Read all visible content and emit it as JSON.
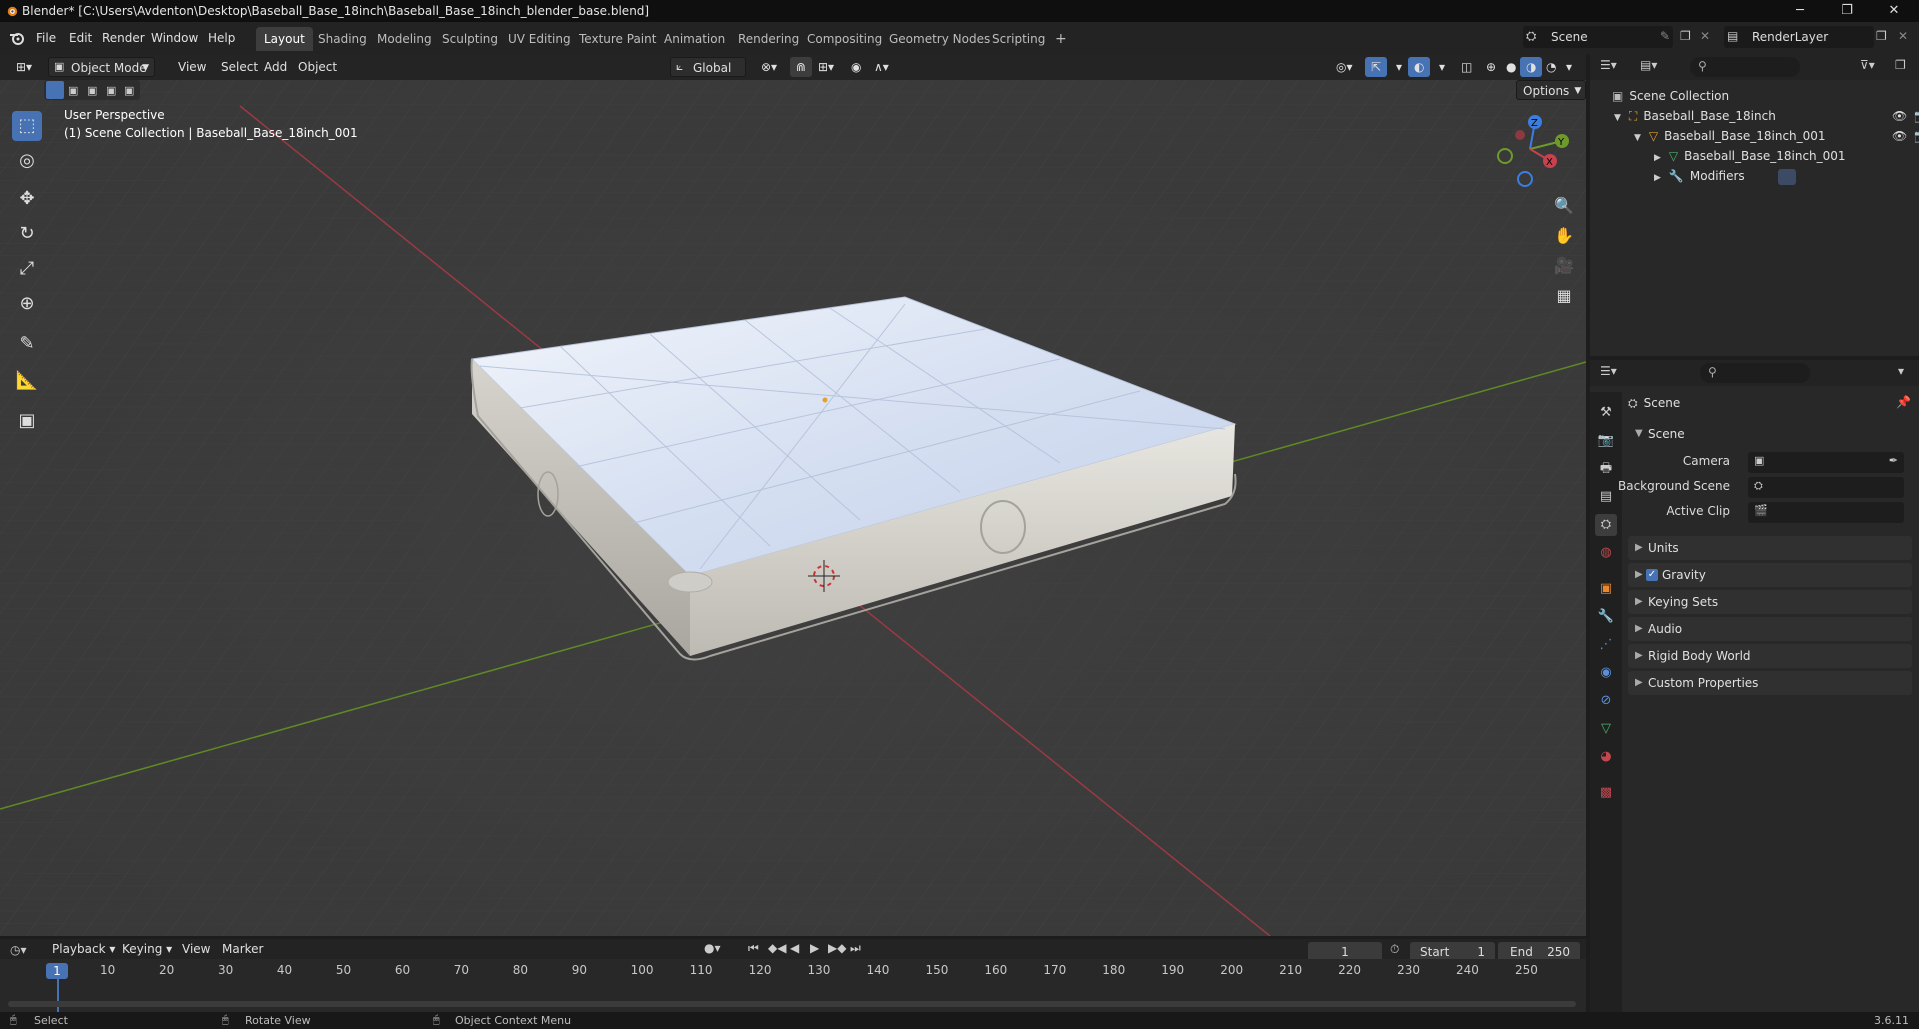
{
  "window": {
    "title": "Blender* [C:\\Users\\Avdenton\\Desktop\\Baseball_Base_18inch\\Baseball_Base_18inch_blender_base.blend]",
    "minimize": "─",
    "maximize": "❐",
    "close": "✕"
  },
  "menus": [
    "File",
    "Edit",
    "Render",
    "Window",
    "Help"
  ],
  "workspaces": [
    "Layout",
    "Shading",
    "Modeling",
    "Sculpting",
    "UV Editing",
    "Texture Paint",
    "Animation",
    "Rendering",
    "Compositing",
    "Geometry Nodes",
    "Scripting",
    "+"
  ],
  "active_workspace": "Layout",
  "scene_selector": "Scene",
  "view_layer": "RenderLayer",
  "viewport_header": {
    "mode": "Object Mode",
    "menus": [
      "View",
      "Select",
      "Add",
      "Object"
    ],
    "orientation": "Global",
    "options": "Options"
  },
  "viewport": {
    "perspective": "User Perspective",
    "collection_info": "(1) Scene Collection | Baseball_Base_18inch_001",
    "axis_x": "X",
    "axis_y": "Y",
    "axis_z": "Z"
  },
  "outliner": {
    "root": "Scene Collection",
    "items": [
      {
        "label": "Baseball_Base_18inch",
        "level": 0
      },
      {
        "label": "Baseball_Base_18inch_001",
        "level": 1
      },
      {
        "label": "Baseball_Base_18inch_001",
        "level": 2
      },
      {
        "label": "Modifiers",
        "level": 2
      }
    ]
  },
  "properties": {
    "context_title": "Scene",
    "section": "Scene",
    "fields": [
      {
        "label": "Camera"
      },
      {
        "label": "Background Scene"
      },
      {
        "label": "Active Clip"
      }
    ],
    "panels": [
      "Units",
      "Gravity",
      "Keying Sets",
      "Audio",
      "Rigid Body World",
      "Custom Properties"
    ],
    "gravity_checked": true
  },
  "timeline": {
    "menus": [
      "Playback",
      "Keying",
      "View",
      "Marker"
    ],
    "current_frame": "1",
    "start_label": "Start",
    "start": "1",
    "end_label": "End",
    "end": "250",
    "ticks": [
      "1",
      "10",
      "20",
      "30",
      "40",
      "50",
      "60",
      "70",
      "80",
      "90",
      "100",
      "110",
      "120",
      "130",
      "140",
      "150",
      "160",
      "170",
      "180",
      "190",
      "200",
      "210",
      "220",
      "230",
      "240",
      "250"
    ]
  },
  "statusbar": {
    "select": "Select",
    "rotate": "Rotate View",
    "context": "Object Context Menu",
    "version": "3.6.11"
  },
  "colors": {
    "accent": "#4772b3",
    "x_axis": "#c9414f",
    "y_axis": "#6e9a2c",
    "z_axis": "#3c7ee0"
  }
}
